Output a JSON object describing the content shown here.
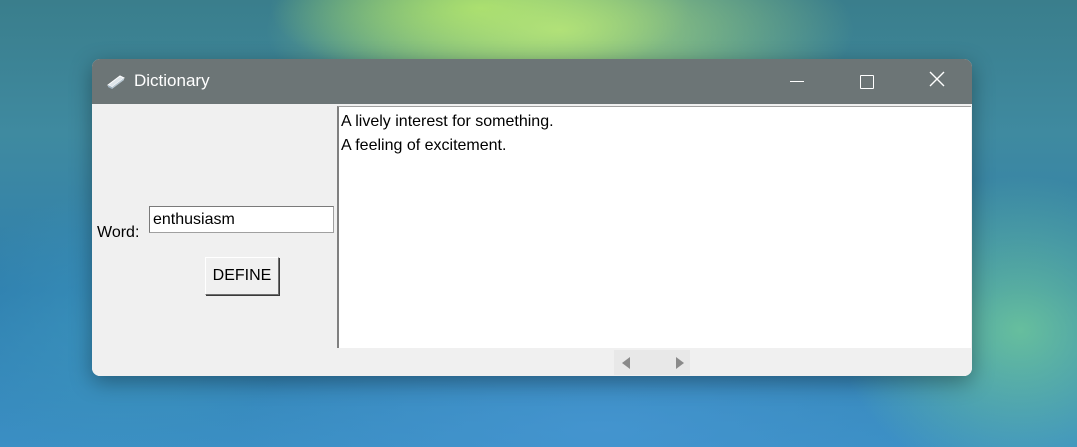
{
  "window": {
    "title": "Dictionary",
    "app_icon": "dictionary-app-icon",
    "controls": {
      "minimize_icon": "minimize-icon",
      "maximize_icon": "maximize-icon",
      "close_icon": "close-icon"
    },
    "titlebar_color": "#6c7576"
  },
  "form": {
    "word_label": "Word:",
    "word_value": "enthusiasm",
    "define_label": "DEFINE"
  },
  "definitions": [
    "A lively interest for something.",
    "A feeling of excitement."
  ],
  "scrollbar": {
    "left_icon": "scroll-left-icon",
    "right_icon": "scroll-right-icon"
  }
}
